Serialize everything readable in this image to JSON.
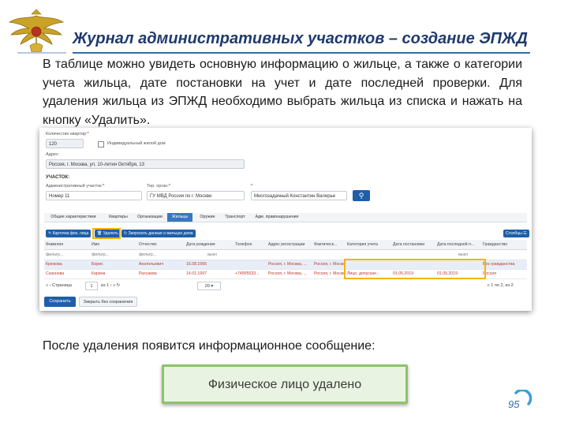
{
  "slide": {
    "title": "Журнал административных участков – создание ЭПЖД",
    "intro": "В таблице можно увидеть основную информацию о жильце, а также о категории учета жильца, дате постановки на учет и дате последней проверки. Для удаления жильца из ЭПЖД необходимо выбрать жильца из списка и нажать на кнопку «Удалить».",
    "after_text": "После удаления появится информационное сообщение:",
    "toast_message": "Физическое лицо удалено",
    "page_number": "95"
  },
  "app": {
    "fields": {
      "apartments_label": "Количество квартир:",
      "apartments_value": "120",
      "individual_house_label": "Индивидуальный жилой дом",
      "address_label": "Адрес:",
      "address_value": "Россия, г. Москва, ул. 10-летия Октября, 13",
      "section_label": "УЧАСТОК:",
      "district_label": "Административный участок:",
      "district_value": "Номер 11",
      "ter_organ_label": "Тер. орган:",
      "ter_organ_value": "ГУ МВД России по г. Москве",
      "inspector_value": "Многозадачный Константин Валерье"
    },
    "tabs": [
      {
        "label": "Общие характеристики"
      },
      {
        "label": "Квартиры"
      },
      {
        "label": "Организации"
      },
      {
        "label": "Жильцы"
      },
      {
        "label": "Оружие"
      },
      {
        "label": "Транспорт"
      },
      {
        "label": "Адм. правонарушение"
      }
    ],
    "toolbar": {
      "card_button": "Карточка физ. лица",
      "delete_button": "Удалить",
      "request_button": "Запросить данные о жильцах дома",
      "columns_button": "Столбцы"
    },
    "grid": {
      "columns": [
        "Фамилия",
        "Имя",
        "Отчество",
        "Дата рождения",
        "Телефон",
        "Адрес регистрации",
        "Фактическ...",
        "Категория учета",
        "Дата постановки",
        "Дата последней п...",
        "Гражданство"
      ],
      "filters": {
        "surname": "фильтр...",
        "name": "фильтр...",
        "patronymic": "фильтр...",
        "birth_date": "выкл",
        "last_check": "выкл"
      },
      "rows": [
        [
          "Крюкова",
          "Борис",
          "Анатольевич",
          "16.08.1966",
          "",
          "Россия, г. Москва, ...",
          "Россия, г. Москва, ...",
          "",
          "",
          "",
          "Без гражданства"
        ],
        [
          "Сазонова",
          "Карина",
          "Рахсаева",
          "14.01.1997",
          "+74995533...",
          "Россия, г. Москва, ...",
          "Россия, г. Москва, ...",
          "Лицо, допускае...",
          "01.05.2019",
          "01.05.2019",
          "Россия"
        ]
      ]
    },
    "pager": {
      "page_label": "Страница",
      "page_value": "1",
      "of_label": "из 1",
      "page_size": "20",
      "summary": "с 1 по 2, из 2"
    },
    "footer": {
      "save_button": "Сохранить",
      "close_button": "Закрыть без сохранения"
    }
  }
}
